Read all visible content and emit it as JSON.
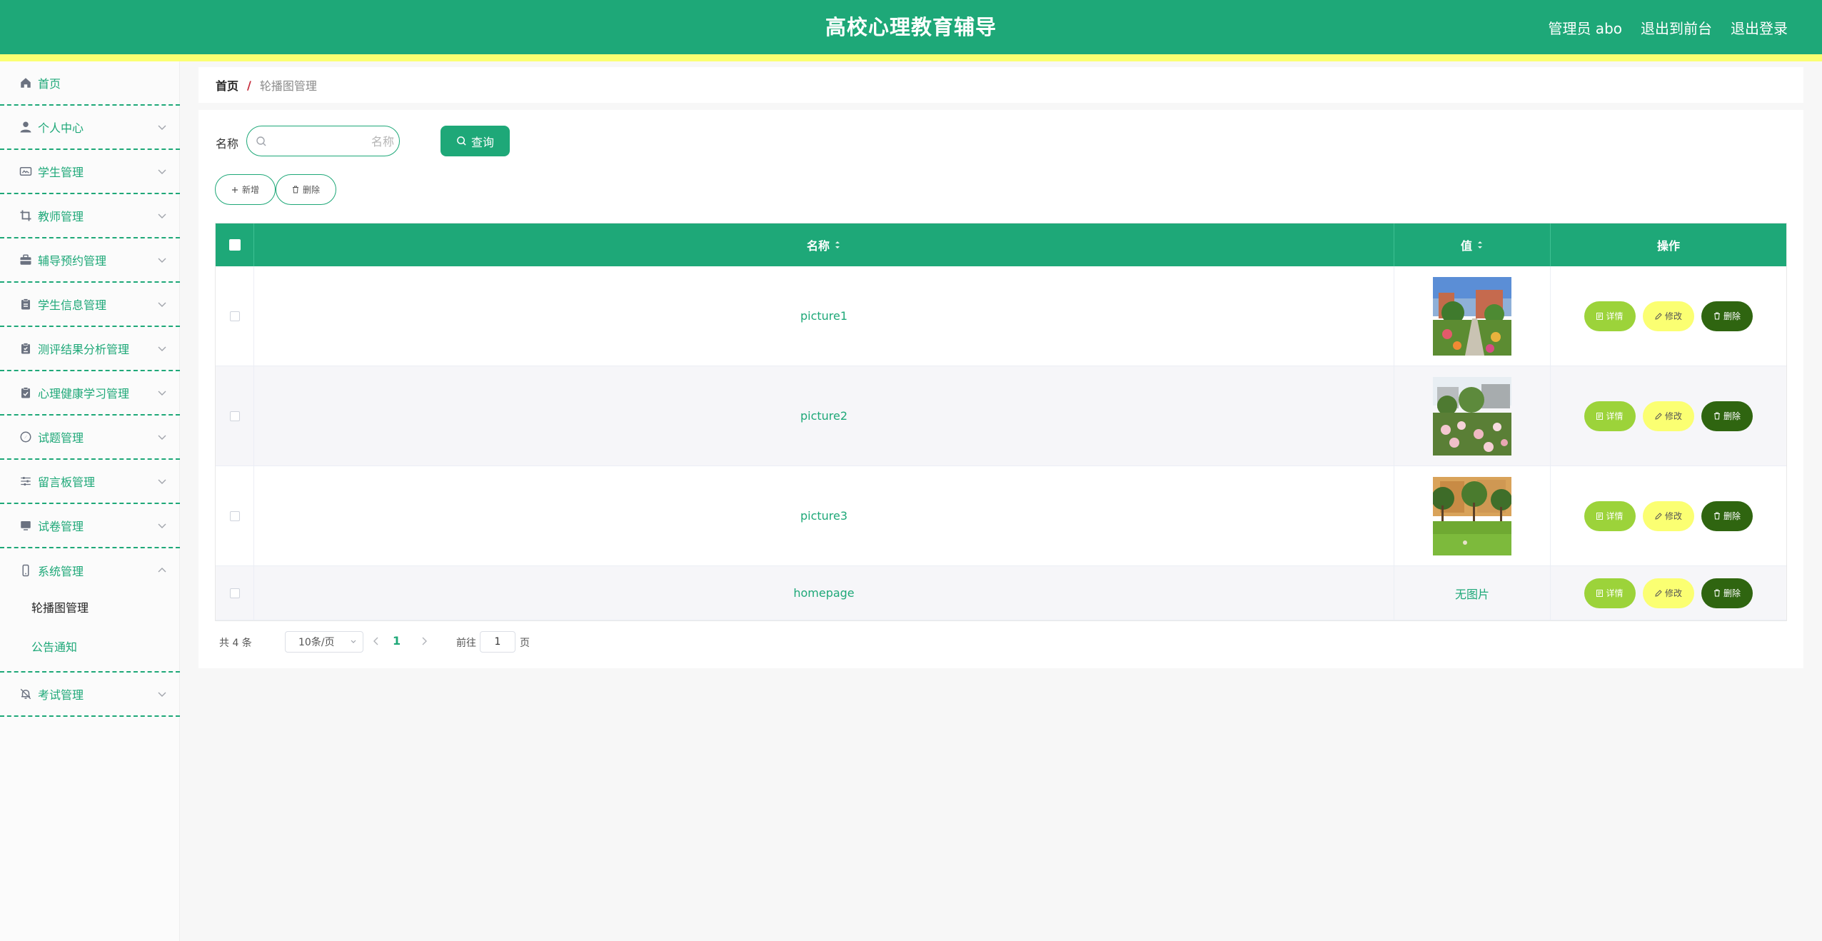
{
  "header": {
    "title": "高校心理教育辅导",
    "admin_label": "管理员 abo",
    "to_front_label": "退出到前台",
    "logout_label": "退出登录"
  },
  "sidebar": {
    "items": [
      {
        "label": "首页",
        "icon": "home-icon"
      },
      {
        "label": "个人中心",
        "icon": "user-icon"
      },
      {
        "label": "学生管理",
        "icon": "id-card-icon"
      },
      {
        "label": "教师管理",
        "icon": "crop-icon"
      },
      {
        "label": "辅导预约管理",
        "icon": "briefcase-icon"
      },
      {
        "label": "学生信息管理",
        "icon": "clipboard-icon"
      },
      {
        "label": "测评结果分析管理",
        "icon": "clipboard-check-icon"
      },
      {
        "label": "心理健康学习管理",
        "icon": "clipboard-list-icon"
      },
      {
        "label": "试题管理",
        "icon": "compass-icon"
      },
      {
        "label": "留言板管理",
        "icon": "sliders-icon"
      },
      {
        "label": "试卷管理",
        "icon": "monitor-icon"
      },
      {
        "label": "系统管理",
        "icon": "phone-icon"
      },
      {
        "label": "考试管理",
        "icon": "bell-off-icon"
      }
    ],
    "system_subitems": [
      {
        "label": "轮播图管理"
      },
      {
        "label": "公告通知"
      }
    ]
  },
  "breadcrumb": {
    "home": "首页",
    "separator": "/",
    "current": "轮播图管理"
  },
  "search": {
    "label": "名称",
    "placeholder": "名称",
    "value": "",
    "query_label": "查询"
  },
  "actions": {
    "add_label": "新增",
    "delete_label": "删除"
  },
  "table": {
    "headers": {
      "name": "名称",
      "value": "值",
      "ops": "操作"
    },
    "rows": [
      {
        "name": "picture1",
        "has_image": true
      },
      {
        "name": "picture2",
        "has_image": true
      },
      {
        "name": "picture3",
        "has_image": true
      },
      {
        "name": "homepage",
        "has_image": false,
        "value_text": "无图片"
      }
    ],
    "op_labels": {
      "detail": "详情",
      "edit": "修改",
      "delete": "删除"
    }
  },
  "pagination": {
    "total_text": "共 4 条",
    "page_size": "10条/页",
    "current_page": "1",
    "goto_label": "前往",
    "goto_value": "1",
    "goto_suffix": "页"
  },
  "colors": {
    "primary": "#1ea878",
    "accent_yellow": "#fbff72",
    "detail_btn": "#9cd33a",
    "delete_btn": "#2f6510"
  }
}
